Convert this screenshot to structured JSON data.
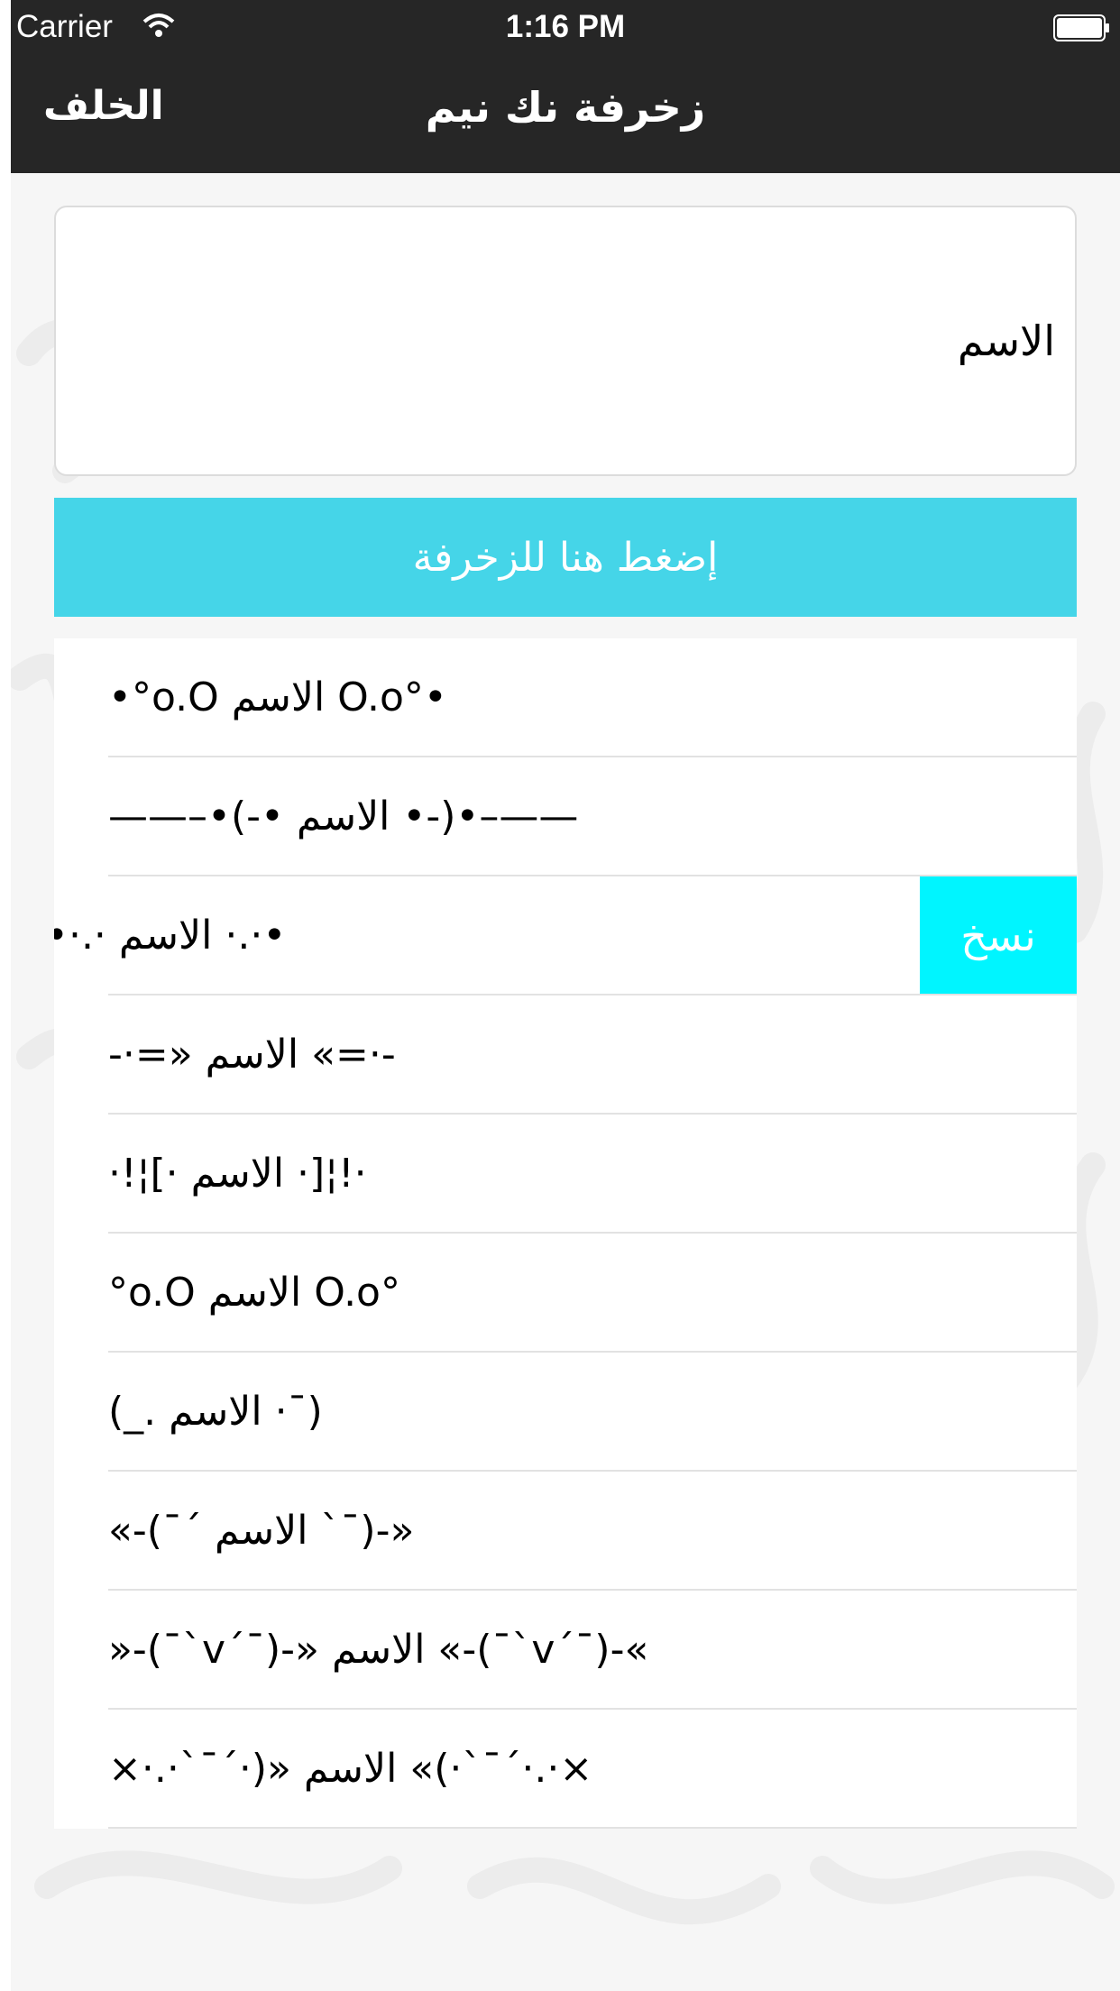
{
  "status_bar": {
    "carrier": "Carrier",
    "time": "1:16 PM",
    "wifi_icon": "wifi-icon",
    "battery_icon": "battery-icon"
  },
  "nav": {
    "back_label": "الخلف",
    "title": "زخرفة نك نيم"
  },
  "name_input": {
    "value": "الاسم"
  },
  "decorate_button": {
    "label": "إضغط هنا للزخرفة"
  },
  "results": [
    {
      "text": "•°o.O الاسم O.o°•"
    },
    {
      "text": "——–•(-• الاسم •-)•–——"
    },
    {
      "text": "•·.· الاسم ·.·•",
      "swiped": true,
      "copy_label": "نسخ"
    },
    {
      "text": "-·=» الاسم «=·-"
    },
    {
      "text": "·!¦[· الاسم ·]¦!·"
    },
    {
      "text": "°o.O الاسم O.o°"
    },
    {
      "text": "(¯· الاسم ._)"
    },
    {
      "text": "«-(¯` الاسم ´¯)-»"
    },
    {
      "text": "»-(¯`v´¯)-» الاسم «-(¯`v´¯)-«"
    },
    {
      "text": "×·.·´¯`·)» الاسم «(·´¯`·.·×"
    }
  ],
  "colors": {
    "bar_background": "#262626",
    "decorate_button": "#45d5e8",
    "copy_button": "#00f5ff",
    "separator": "#e2e2e2"
  }
}
